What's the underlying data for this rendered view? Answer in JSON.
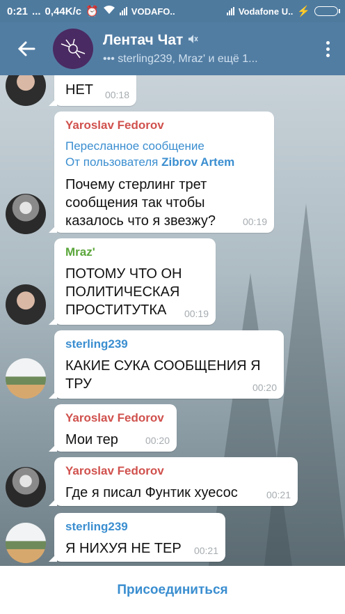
{
  "status_bar": {
    "time": "0:21",
    "dots": "...",
    "speed": "0,44K/c",
    "carrier1": "VODAFO..",
    "carrier2": "Vodafone U..",
    "charge": "⚡"
  },
  "header": {
    "title": "Лентач Чат",
    "subtitle": "sterling239, Mraz' и ещё 1..."
  },
  "messages": [
    {
      "sender": "",
      "text": "НЕТ",
      "time": "00:18"
    },
    {
      "sender": "Yaroslav Fedorov",
      "sender_color": "#d0514d",
      "fwd_line1": "Пересланное сообщение",
      "fwd_prefix": "От пользователя",
      "fwd_user": "Zibrov Artem",
      "text": "Почему стерлинг трет сообщения так чтобы казалось что я звезжу?",
      "time": "00:19"
    },
    {
      "sender": "Mraz'",
      "sender_color": "#5aa63a",
      "text": "ПОТОМУ ЧТО ОН ПОЛИТИЧЕСКАЯ ПРОСТИТУТКА",
      "time": "00:19"
    },
    {
      "sender": "sterling239",
      "sender_color": "#3a8ed0",
      "text": "КАКИЕ СУКА СООБЩЕНИЯ Я ТРУ",
      "time": "00:20"
    },
    {
      "sender": "Yaroslav Fedorov",
      "sender_color": "#d0514d",
      "text": "Мои тер",
      "time": "00:20"
    },
    {
      "sender": "Yaroslav Fedorov",
      "sender_color": "#d0514d",
      "text": "Где я писал Фунтик хуесос",
      "time": "00:21"
    },
    {
      "sender": "sterling239",
      "sender_color": "#3a8ed0",
      "text": "Я НИХУЯ НЕ ТЕР",
      "time": "00:21"
    }
  ],
  "footer": {
    "join_label": "Присоединиться"
  },
  "colors": {
    "appbar": "#527da3",
    "statusbar": "#4e7a9e",
    "accent": "#3a8ed0"
  }
}
